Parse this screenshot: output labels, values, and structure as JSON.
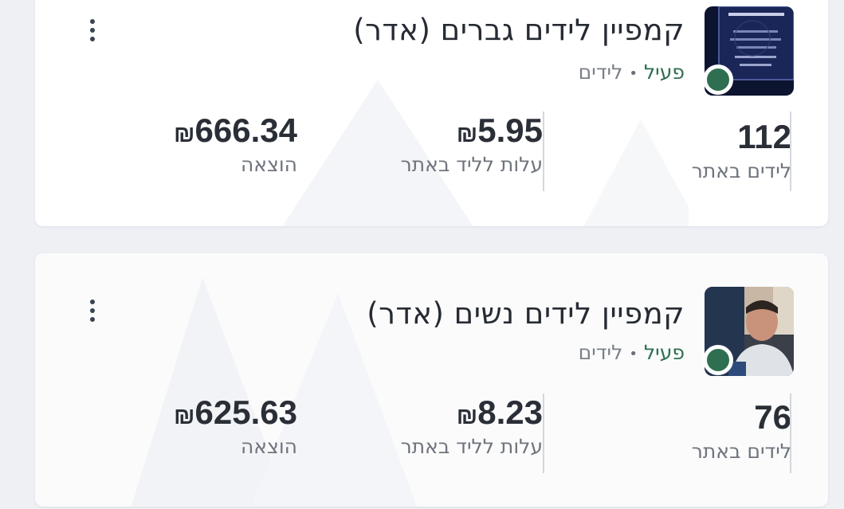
{
  "campaigns": [
    {
      "title": "קמפיין לידים גברים (אדר)",
      "status": "פעיל",
      "separator": "•",
      "type": "לידים",
      "thumbnail_icon": "campaign-poster-image",
      "metrics": {
        "leads": {
          "value": "112",
          "label": "לידים באתר"
        },
        "cost_per_lead": {
          "currency": "₪",
          "value": "5.95",
          "label": "עלות לליד באתר"
        },
        "spend": {
          "currency": "₪",
          "value": "666.34",
          "label": "הוצאה"
        }
      }
    },
    {
      "title": "קמפיין לידים נשים (אדר)",
      "status": "פעיל",
      "separator": "•",
      "type": "לידים",
      "thumbnail_icon": "campaign-video-image",
      "metrics": {
        "leads": {
          "value": "76",
          "label": "לידים באתר"
        },
        "cost_per_lead": {
          "currency": "₪",
          "value": "8.23",
          "label": "עלות לליד באתר"
        },
        "spend": {
          "currency": "₪",
          "value": "625.63",
          "label": "הוצאה"
        }
      }
    }
  ],
  "colors": {
    "active": "#2d6f50",
    "text": "#262b33",
    "muted": "#6f747d"
  }
}
